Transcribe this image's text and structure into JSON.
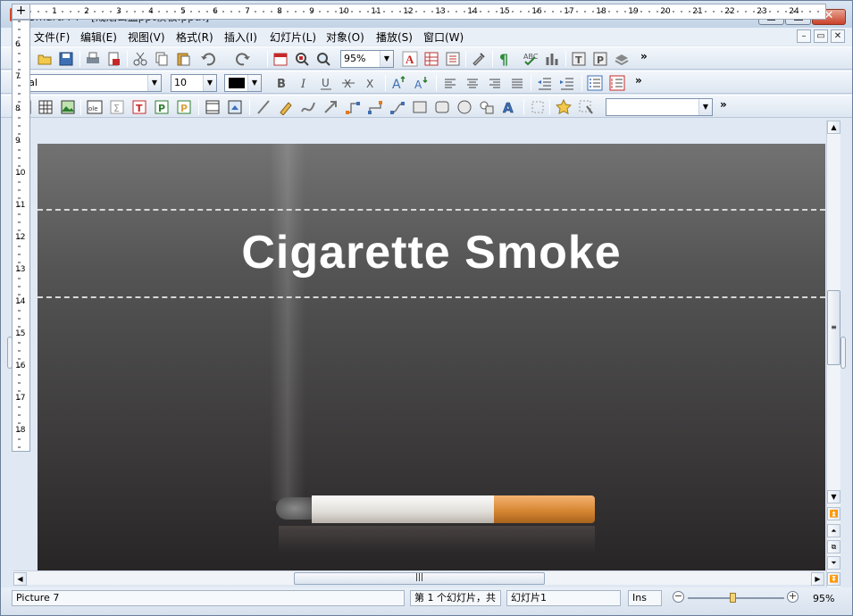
{
  "window": {
    "title": "SmartPPT - [戒烟公益ppt模板.pptx]",
    "app_icon_letter": "P",
    "close_glyph": "✕"
  },
  "menu": [
    "文件(F)",
    "编辑(E)",
    "视图(V)",
    "格式(R)",
    "插入(I)",
    "幻灯片(L)",
    "对象(O)",
    "播放(S)",
    "窗口(W)"
  ],
  "mdi_buttons": [
    "–",
    "▭",
    "✕"
  ],
  "toolbar": {
    "zoom_value": "95%",
    "font_name": "Arial",
    "font_size": "10",
    "shape_style_value": "",
    "overflow": "»"
  },
  "ruler": {
    "h_numbers": [
      "1",
      "2",
      "3",
      "4",
      "5",
      "6",
      "7",
      "8",
      "9",
      "10",
      "11",
      "12",
      "13",
      "14",
      "15",
      "16",
      "17",
      "18",
      "19",
      "20",
      "21",
      "22",
      "23",
      "24"
    ],
    "v_numbers": [
      "6",
      "7",
      "8",
      "9",
      "10",
      "11",
      "12",
      "13",
      "14",
      "15",
      "16",
      "17",
      "18"
    ]
  },
  "slide": {
    "title": "Cigarette Smoke"
  },
  "status": {
    "selection": "Picture 7",
    "slide_info": "第 1 个幻灯片，共",
    "slide_name": "幻灯片1",
    "mode": "Ins",
    "zoom": "95%"
  },
  "colors": {
    "slide_top": "#727272",
    "slide_bottom": "#282526",
    "filter": "#d78732",
    "title": "#ffffff"
  }
}
